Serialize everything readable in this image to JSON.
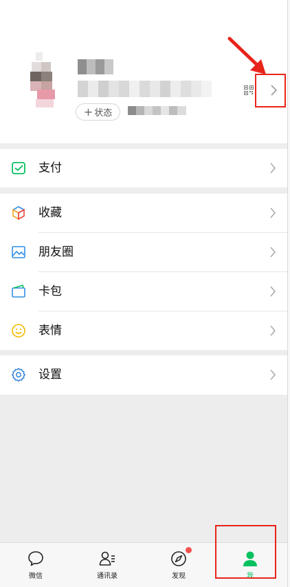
{
  "profile": {
    "status_button_label": "状态",
    "status_plus": "+"
  },
  "menu": {
    "pay": {
      "label": "支付",
      "icon": "wallet-check-icon"
    },
    "favorites": {
      "label": "收藏",
      "icon": "cube-icon"
    },
    "moments": {
      "label": "朋友圈",
      "icon": "image-icon"
    },
    "cards": {
      "label": "卡包",
      "icon": "card-icon"
    },
    "stickers": {
      "label": "表情",
      "icon": "smiley-icon"
    },
    "settings": {
      "label": "设置",
      "icon": "gear-icon"
    }
  },
  "tabbar": {
    "tabs": [
      {
        "label": "微信",
        "icon": "chat-bubble-icon",
        "active": false
      },
      {
        "label": "通讯录",
        "icon": "contacts-icon",
        "active": false
      },
      {
        "label": "发现",
        "icon": "compass-icon",
        "active": false,
        "badge": true
      },
      {
        "label": "我",
        "icon": "person-icon",
        "active": true
      }
    ]
  },
  "colors": {
    "wechat_green": "#07c160",
    "annotation_red": "#e8231a",
    "badge_red": "#f2524f",
    "background": "#ededed"
  }
}
